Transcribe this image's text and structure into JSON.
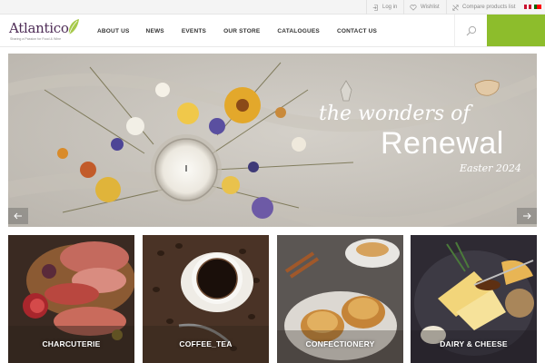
{
  "topbar": {
    "login": "Log in",
    "wishlist": "Wishlist",
    "compare": "Compare products list"
  },
  "logo": {
    "name": "Atlantico",
    "tagline": "Sharing a Passion for Food & Wine"
  },
  "nav": {
    "items": [
      "ABOUT US",
      "NEWS",
      "EVENTS",
      "OUR STORE",
      "CATALOGUES",
      "CONTACT US"
    ]
  },
  "banner": {
    "line1": "the wonders of",
    "line2": "Renewal",
    "line3": "Easter 2024"
  },
  "categories": [
    {
      "label": "CHARCUTERIE"
    },
    {
      "label": "COFFEE_TEA"
    },
    {
      "label": "CONFECTIONERY"
    },
    {
      "label": "DAIRY & CHEESE"
    }
  ],
  "colors": {
    "brand_purple": "#4e2c56",
    "brand_green": "#8dbd2c"
  }
}
